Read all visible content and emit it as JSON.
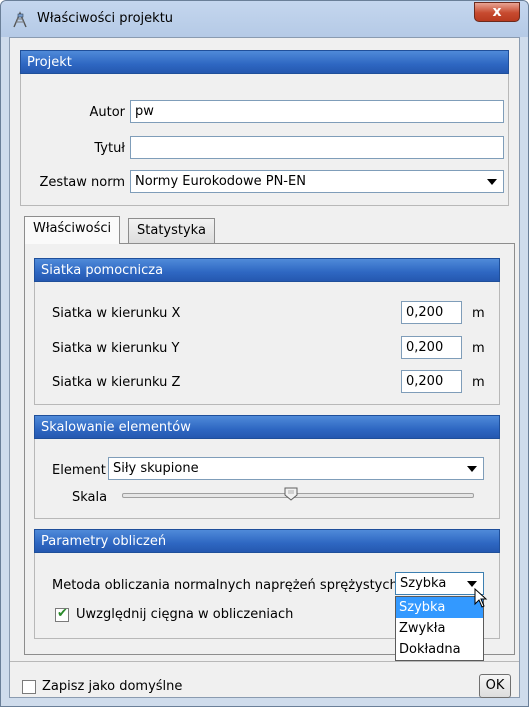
{
  "window": {
    "title": "Właściwości projektu",
    "close_label": "x"
  },
  "projekt": {
    "header": "Projekt",
    "autor_label": "Autor",
    "autor_value": "pw",
    "tytul_label": "Tytuł",
    "tytul_value": "",
    "zestaw_label": "Zestaw norm",
    "zestaw_value": "Normy Eurokodowe PN-EN"
  },
  "tabs": [
    {
      "label": "Właściwości",
      "active": true
    },
    {
      "label": "Statystyka",
      "active": false
    }
  ],
  "siatka": {
    "header": "Siatka pomocnicza",
    "rows": [
      {
        "label": "Siatka w kierunku X",
        "value": "0,200",
        "unit": "m"
      },
      {
        "label": "Siatka w kierunku Y",
        "value": "0,200",
        "unit": "m"
      },
      {
        "label": "Siatka w kierunku Z",
        "value": "0,200",
        "unit": "m"
      }
    ]
  },
  "skalowanie": {
    "header": "Skalowanie elementów",
    "element_label": "Element",
    "element_value": "Siły skupione",
    "skala_label": "Skala",
    "skala_level": 0.48
  },
  "parametry": {
    "header": "Parametry obliczeń",
    "metoda_label": "Metoda obliczania normalnych naprężeń sprężystych",
    "metoda_value": "Szybka",
    "metoda_options": [
      "Szybka",
      "Zwykła",
      "Dokładna"
    ],
    "cięgna_label": "Uwzględnij cięgna w obliczeniach",
    "cięgna_checked": true
  },
  "footer": {
    "default_label": "Zapisz jako domyślne",
    "default_checked": false,
    "ok_label": "OK"
  },
  "colors": {
    "group_header": "#2e67c2",
    "selection": "#3399ff",
    "close_button": "#c74a2f"
  }
}
